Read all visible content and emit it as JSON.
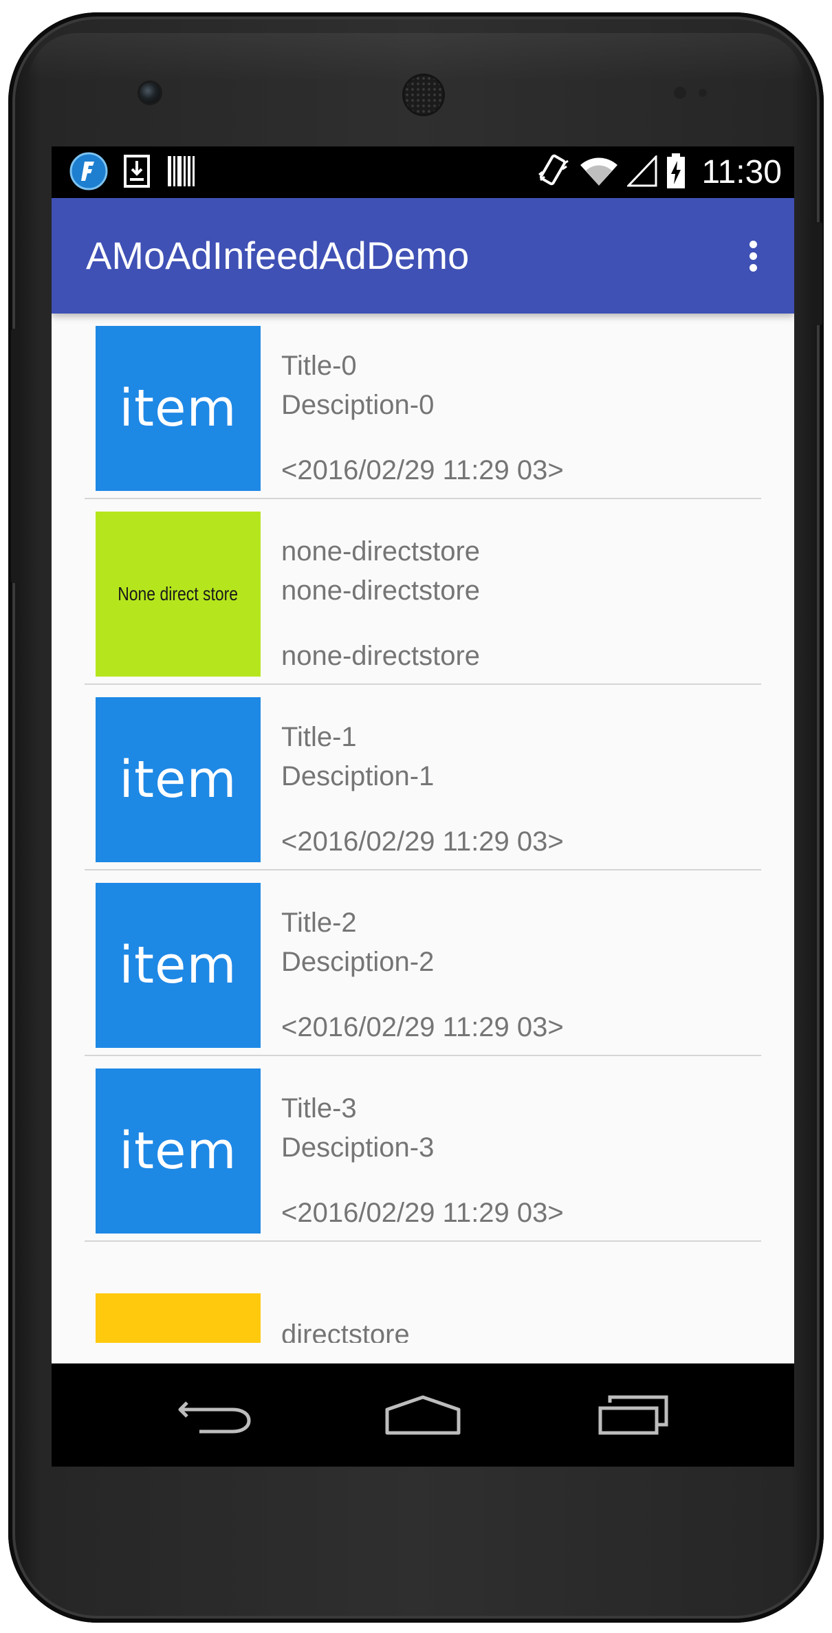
{
  "status_bar": {
    "left_icons": [
      "freeline-app-icon",
      "download-icon",
      "barcode-icon"
    ],
    "right_icons": [
      "vibrate-icon",
      "wifi-icon",
      "cell-signal-icon",
      "battery-charging-icon"
    ],
    "time": "11:30"
  },
  "app_bar": {
    "title": "AMoAdInfeedAdDemo",
    "overflow_icon": "more-vert-icon"
  },
  "list": {
    "items": [
      {
        "thumb_label": "item",
        "thumb_color": "#1e88e5",
        "title": "Title-0",
        "description": "Desciption-0",
        "meta": "<2016/02/29 11:29 03>"
      },
      {
        "thumb_label": "None direct store",
        "thumb_color": "#b5e61d",
        "title": "none-directstore",
        "description": "none-directstore",
        "meta": "none-directstore"
      },
      {
        "thumb_label": "item",
        "thumb_color": "#1e88e5",
        "title": "Title-1",
        "description": "Desciption-1",
        "meta": "<2016/02/29 11:29 03>"
      },
      {
        "thumb_label": "item",
        "thumb_color": "#1e88e5",
        "title": "Title-2",
        "description": "Desciption-2",
        "meta": "<2016/02/29 11:29 03>"
      },
      {
        "thumb_label": "item",
        "thumb_color": "#1e88e5",
        "title": "Title-3",
        "description": "Desciption-3",
        "meta": "<2016/02/29 11:29 03>"
      },
      {
        "thumb_label": "",
        "thumb_color": "#ffc90e",
        "title": "directstore",
        "description": "",
        "meta": ""
      }
    ]
  },
  "nav_bar": {
    "back_icon": "back-icon",
    "home_icon": "home-icon",
    "recents_icon": "recents-icon"
  },
  "colors": {
    "app_bar": "#3f51b5",
    "item_blue": "#1e88e5",
    "ad_green": "#b5e61d",
    "ad_yellow": "#ffc90e",
    "text_secondary": "#757575",
    "list_background": "#fafafa"
  }
}
